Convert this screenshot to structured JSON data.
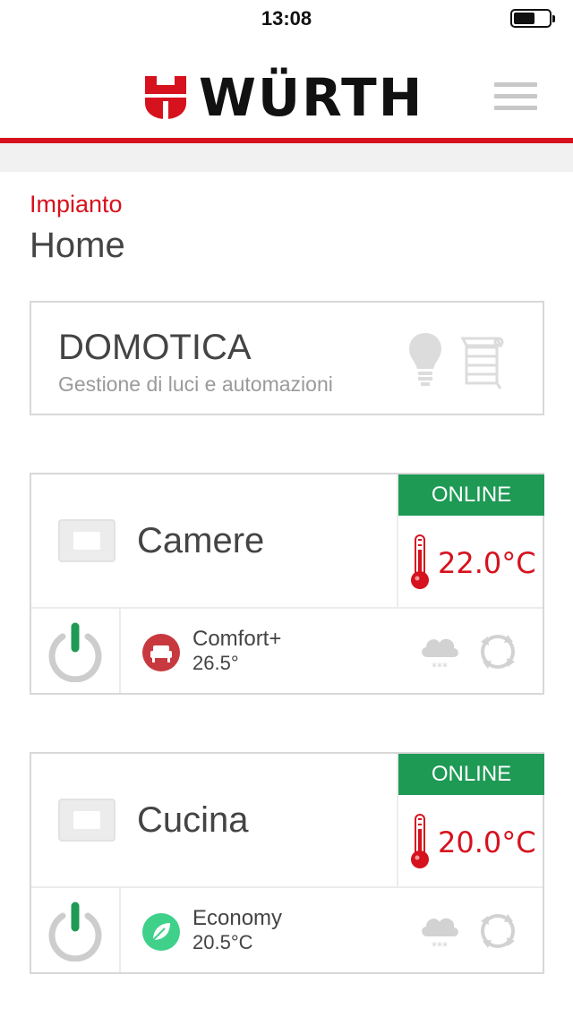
{
  "status_bar": {
    "time": "13:08",
    "battery_level": 0.6
  },
  "header": {
    "brand": "WÜRTH"
  },
  "page": {
    "subtitle": "Impianto",
    "title": "Home"
  },
  "domotica": {
    "title": "DOMOTICA",
    "subtitle": "Gestione di luci e automazioni"
  },
  "zones": [
    {
      "name": "Camere",
      "status": "ONLINE",
      "temperature": "22.0°C",
      "mode_label": "Comfort+",
      "mode_value": "26.5°",
      "mode_color": "#c7393f"
    },
    {
      "name": "Cucina",
      "status": "ONLINE",
      "temperature": "20.0°C",
      "mode_label": "Economy",
      "mode_value": "20.5°C",
      "mode_color": "#3fd08a"
    }
  ],
  "colors": {
    "brand_red": "#d6121e",
    "online_green": "#1e9a55",
    "power_green": "#1e9a55"
  }
}
